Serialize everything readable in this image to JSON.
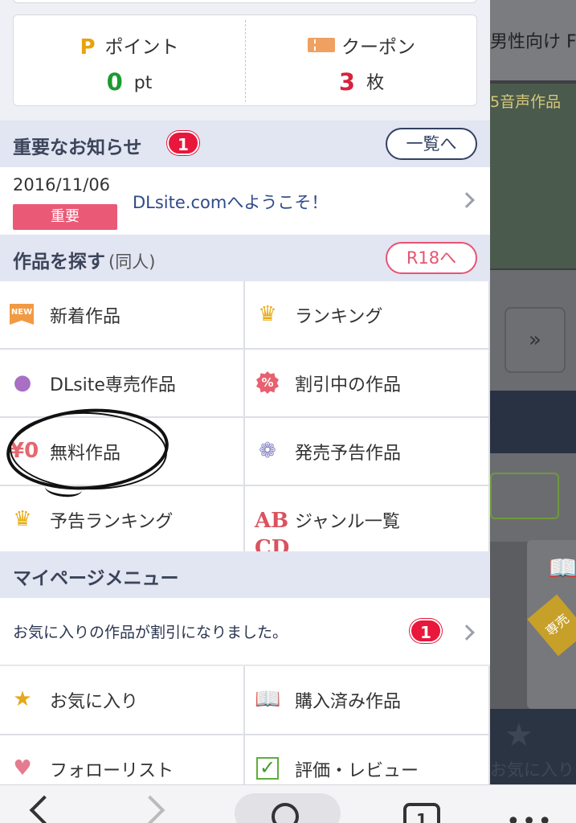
{
  "background_page": {
    "tab_label": "男性向け F",
    "banner_title": "5音声作品",
    "next_arrow": "»",
    "book_icon": "book-icon",
    "badge": "専売",
    "favorite_label": "お気に入り"
  },
  "points": {
    "point_icon_letter": "P",
    "point_label": "ポイント",
    "point_value": "0",
    "point_unit": "pt",
    "coupon_label": "クーポン",
    "coupon_value": "3",
    "coupon_unit": "枚"
  },
  "notices": {
    "title": "重要なお知らせ",
    "count": "1",
    "list_button": "一覧へ",
    "item": {
      "date": "2016/11/06",
      "tag": "重要",
      "text": "DLsite.comへようこそ！"
    }
  },
  "explore": {
    "title": "作品を探す",
    "subtitle": "(同人)",
    "r18_button": "R18へ",
    "items": [
      {
        "label": "新着作品",
        "icon": "new-icon"
      },
      {
        "label": "ランキング",
        "icon": "crown-icon"
      },
      {
        "label": "DLsite専売作品",
        "icon": "pin-icon"
      },
      {
        "label": "割引中の作品",
        "icon": "discount-icon"
      },
      {
        "label": "無料作品",
        "icon": "zero-yen-icon"
      },
      {
        "label": "発売予告作品",
        "icon": "sprout-icon"
      },
      {
        "label": "予告ランキング",
        "icon": "crown-icon"
      },
      {
        "label": "ジャンル一覧",
        "icon": "abcd-icon"
      }
    ]
  },
  "mypage": {
    "title": "マイページメニュー",
    "notice_text": "お気に入りの作品が割引になりました。",
    "notice_count": "1",
    "items": [
      {
        "label": "お気に入り",
        "icon": "star-icon"
      },
      {
        "label": "購入済み作品",
        "icon": "book-icon"
      },
      {
        "label": "フォローリスト",
        "icon": "heart-icon"
      },
      {
        "label": "評価・レビュー",
        "icon": "check-icon"
      }
    ]
  },
  "toolbar": {
    "tab_count": "1",
    "more_glyph": "•••"
  },
  "colors": {
    "accent_red": "#e8173b",
    "point_green": "#1e9a2f",
    "navy": "#334162",
    "pink": "#e65473",
    "section_bg": "#e2e5f2"
  }
}
